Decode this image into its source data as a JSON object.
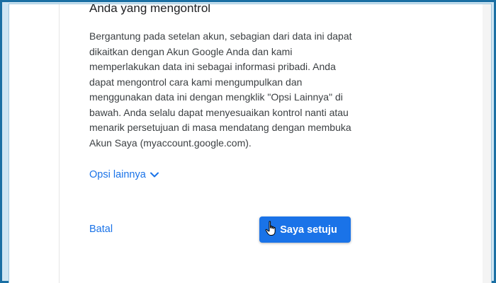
{
  "section": {
    "title": "Anda yang mengontrol",
    "body": "Bergantung pada setelan akun, sebagian dari data ini dapat dikaitkan dengan Akun Google Anda dan kami memperlakukan data ini sebagai informasi pribadi. Anda dapat mengontrol cara kami mengumpulkan dan menggunakan data ini dengan mengklik \"Opsi Lainnya\" di bawah. Anda selalu dapat menyesuaikan kontrol nanti atau menarik persetujuan di masa mendatang dengan membuka Akun Saya (myaccount.google.com)."
  },
  "more_options": {
    "label": "Opsi lainnya",
    "icon": "chevron-down-icon"
  },
  "actions": {
    "cancel_label": "Batal",
    "agree_label": "Saya setuju"
  },
  "colors": {
    "link": "#1a73e8",
    "primary_button": "#1a73e8",
    "frame_border": "#1a6fa3"
  },
  "cursor": {
    "icon": "hand-pointer-icon"
  }
}
